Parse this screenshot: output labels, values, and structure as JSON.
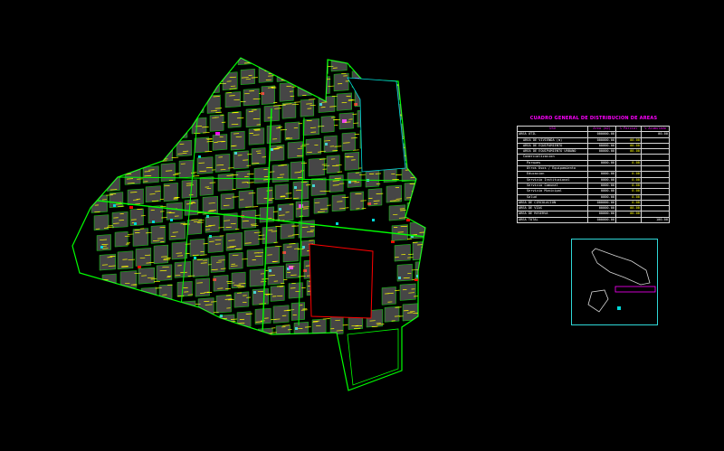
{
  "area_table": {
    "title": "CUADRO GENERAL DE DISTRIBUCION DE AREAS",
    "headers": [
      "USO",
      "Area (m2)",
      "% Parcial",
      "% Acumulado"
    ],
    "rows": [
      {
        "cells": [
          "AREA UTIL",
          "000000.00",
          "",
          "00.00"
        ],
        "indent": 0
      },
      {
        "cells": [
          "AREA DE VIVIENDA (m)",
          "000000.00",
          "00.00",
          ""
        ],
        "indent": 1
      },
      {
        "cells": [
          "AREA DE EQUIPAMIENTO",
          "00000.00",
          "00.00",
          ""
        ],
        "indent": 1
      },
      {
        "cells": [
          "AREA DE EQUIPAMIENTO URBANO",
          "00000.00",
          "00.00",
          ""
        ],
        "indent": 1
      },
      {
        "cells": [
          "Comercializacion",
          "",
          "",
          ""
        ],
        "indent": 1
      },
      {
        "cells": [
          "Parques",
          "0000.00",
          "0.00",
          ""
        ],
        "indent": 2
      },
      {
        "cells": [
          "Otros Usos / Equipamiento",
          "",
          "",
          ""
        ],
        "indent": 2
      },
      {
        "cells": [
          "Educacion",
          "0000.00",
          "0.00",
          ""
        ],
        "indent": 2
      },
      {
        "cells": [
          "Servicio Institucional",
          "0000.00",
          "0.00",
          ""
        ],
        "indent": 2
      },
      {
        "cells": [
          "Servicio Comunal",
          "0000.00",
          "0.00",
          ""
        ],
        "indent": 2
      },
      {
        "cells": [
          "Servicio Municipal",
          "0000.00",
          "0.00",
          ""
        ],
        "indent": 2
      },
      {
        "cells": [
          "Salud",
          "0000.00",
          "0.00",
          ""
        ],
        "indent": 2
      },
      {
        "cells": [
          "AREA DE CIRCULACION",
          "000000.00",
          "0.00",
          ""
        ],
        "indent": 0
      },
      {
        "cells": [
          "AREA DE VIAS",
          "00000.00",
          "00.00",
          ""
        ],
        "indent": 0
      },
      {
        "cells": [
          "AREA DE RESERVA",
          "00000.00",
          "00.00",
          ""
        ],
        "indent": 0
      },
      {
        "cells": [
          "AREA TOTAL",
          "000000.00",
          "",
          "100.00"
        ],
        "indent": 0
      }
    ]
  },
  "colors": {
    "background": "#000000",
    "boundary": "#00ff00",
    "blocks": "#c8c8c8",
    "lots": "#ffff00",
    "roads": "#00ff00",
    "edge_red": "#ff0000",
    "cyan": "#00d8d8",
    "magenta": "#ff00ff",
    "table_title": "#ff00ff",
    "table_border": "#d8d8d8"
  }
}
